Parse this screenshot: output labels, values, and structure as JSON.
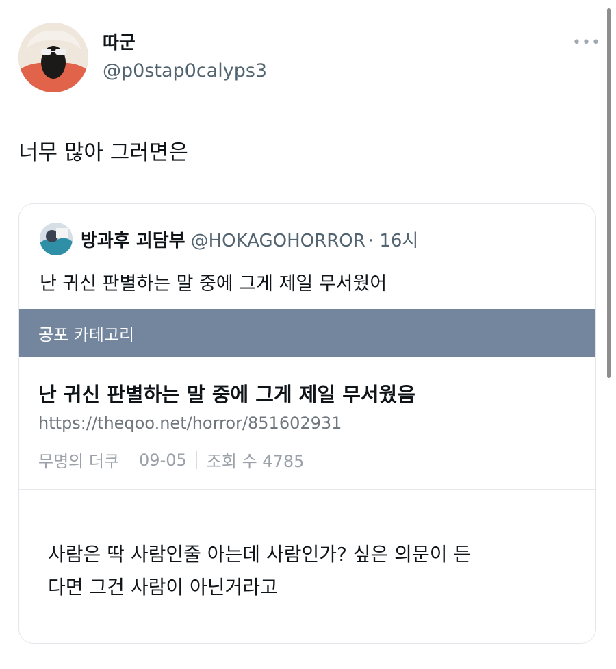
{
  "tweet": {
    "author_name": "따군",
    "author_handle": "@p0stap0calyps3",
    "text": "너무 많아 그러면은",
    "more_icon": "more-horizontal-icon"
  },
  "quote": {
    "author_name": "방과후 괴담부",
    "author_handle": "@HOKAGOHORROR",
    "time": "· 16시",
    "text": "난 귀신 판별하는 말 중에 그게 제일 무서웠어",
    "card": {
      "category": "공포 카테고리",
      "title": "난 귀신 판별하는 말 중에 그게 제일 무서웠음",
      "url": "https://theqoo.net/horror/851602931",
      "meta": {
        "author": "무명의 더쿠",
        "date": "09-05",
        "views": "조회 수 4785"
      },
      "body_line1": "사람은 딱 사람인줄 아는데 사람인가? 싶은 의문이 든",
      "body_line2": "다면 그건 사람이 아닌거라고"
    }
  },
  "colors": {
    "category_bar": "#73869e",
    "secondary_text": "#536471"
  }
}
